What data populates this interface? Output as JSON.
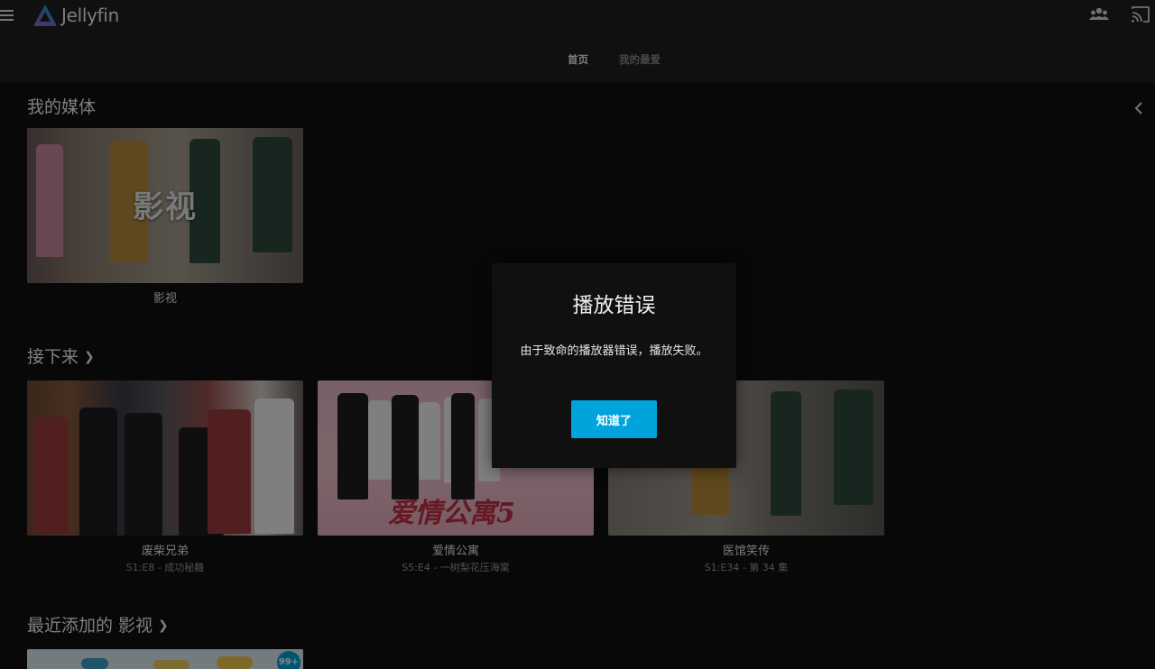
{
  "app": {
    "logo_text": "Jellyfin",
    "accent_color": "#00a4dc",
    "icons": [
      "menu-icon",
      "jellyfin-logo-icon",
      "users-icon",
      "cast-icon",
      "chevron-left-icon",
      "chevron-right-icon"
    ]
  },
  "header": {
    "tabs": [
      {
        "label": "首页",
        "active": true
      },
      {
        "label": "我的最爱",
        "active": false
      }
    ]
  },
  "my_media": {
    "title": "我的媒体",
    "items": [
      {
        "label": "影视",
        "overlay_text": "影视"
      }
    ]
  },
  "next_up": {
    "title": "接下来",
    "items": [
      {
        "title": "废柴兄弟",
        "subtitle": "S1:E8 - 成功秘籍"
      },
      {
        "title": "爱情公寓",
        "subtitle": "S5:E4 - 一树梨花压海棠",
        "poster_text": "爱情公寓5"
      },
      {
        "title": "医馆笑传",
        "subtitle": "S1:E34 - 第 34 集"
      }
    ]
  },
  "recently_added": {
    "title": "最近添加的 影视",
    "badge": "99+"
  },
  "dialog": {
    "title": "播放错误",
    "message": "由于致命的播放器错误，播放失败。",
    "button_label": "知道了"
  }
}
